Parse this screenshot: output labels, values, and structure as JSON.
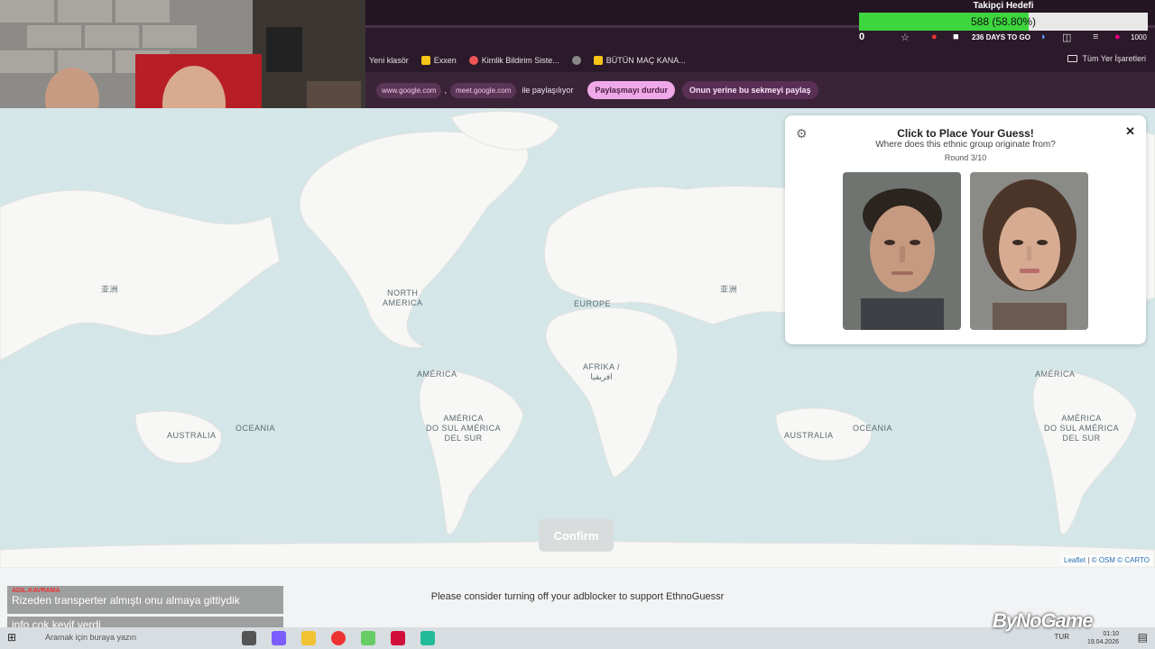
{
  "stream_goal": {
    "title": "Takipçi Hedefi",
    "progress_text": "588 (58.80%)",
    "progress_fraction": 0.588
  },
  "toolbar": {
    "counter": "0",
    "days_text": "236 DAYS TO GO",
    "badge_count": "1000"
  },
  "bookmarks": {
    "items": [
      {
        "label": "Yeni klasör",
        "color": "#2b1a2a"
      },
      {
        "label": "Exxen",
        "color": "#f5c518"
      },
      {
        "label": "Kimlik Bildirim Siste...",
        "color": "#e55"
      },
      {
        "label": "",
        "color": "#888"
      },
      {
        "label": "BÜTÜN MAÇ KANA...",
        "color": "#f5c518"
      }
    ],
    "all_bookmarks": "Tüm Yer İşaretleri"
  },
  "share_bar": {
    "domain1": "www.google.com",
    "separator": ",",
    "domain2": "meet.google.com",
    "sharing_text": "ile paylaşılıyor",
    "stop_button": "Paylaşmayı durdur",
    "share_this_button": "Onun yerine bu sekmeyi paylaş"
  },
  "panel": {
    "title": "Click to Place Your Guess!",
    "subtitle": "Where does this ethnic group originate from?",
    "round": "Round 3/10",
    "close_label": "✕",
    "gear_label": "⚙"
  },
  "map": {
    "labels": [
      {
        "text": "亚洲"
      },
      {
        "text": "NORTH\nAMERICA"
      },
      {
        "text": "EUROPE"
      },
      {
        "text": "亚洲"
      },
      {
        "text": "AMÉRICA"
      },
      {
        "text": "AFRIKA /\nافريقيا"
      },
      {
        "text": "AMÉRICA"
      },
      {
        "text": "AUSTRALIA"
      },
      {
        "text": "OCEANIA"
      },
      {
        "text": "AMÉRICA\nDO SUL AMÉRICA\nDEL SUR"
      },
      {
        "text": "AUSTRALIA"
      },
      {
        "text": "OCEANIA"
      },
      {
        "text": "AMÉRICA\nDO SUL AMÉRICA\nDEL SUR"
      }
    ],
    "attribution": {
      "leaflet": "Leaflet",
      "sep1": "|",
      "osm": "© OSM",
      "carto": "© CARTO"
    }
  },
  "confirm_label": "Confirm",
  "adblock_message": "Please consider turning off your adblocker to support EthnoGuessr",
  "chat": [
    {
      "user": "ADIL.KAVRAMA",
      "message": "Rizeden transperter almıştı onu almaya gittiydik"
    },
    {
      "user": "",
      "message": "info çok keyif verdi"
    }
  ],
  "taskbar": {
    "search_placeholder": "Aramak için buraya yazın",
    "lang": "TUR",
    "time": "01:10",
    "date": "19.04.2026"
  },
  "logo_text": "ByNoGame"
}
